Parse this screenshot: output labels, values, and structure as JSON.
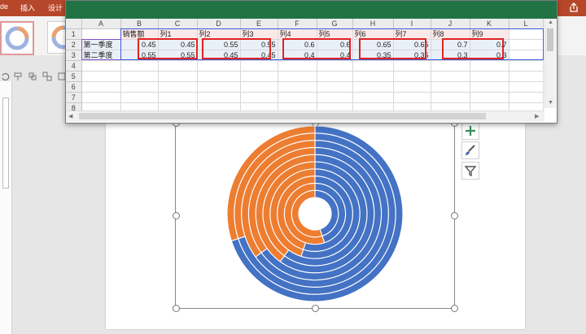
{
  "powerpoint": {
    "tabs": [
      {
        "label": "de"
      },
      {
        "label": "插入"
      },
      {
        "label": "设计"
      }
    ]
  },
  "excel": {
    "column_headers": [
      "A",
      "B",
      "C",
      "D",
      "E",
      "F",
      "G",
      "H",
      "I",
      "J",
      "K",
      "L"
    ],
    "row_numbers": [
      "1",
      "2",
      "3",
      "4",
      "5",
      "6",
      "7",
      "8"
    ],
    "header_row": [
      "销售额",
      "列1",
      "列2",
      "列3",
      "列4",
      "列5",
      "列6",
      "列7",
      "列8",
      "列9"
    ],
    "rows": [
      {
        "label": "第一季度",
        "values": [
          "0.45",
          "0.45",
          "0.55",
          "0.55",
          "0.6",
          "0.6",
          "0.65",
          "0.65",
          "0.7",
          "0.7"
        ]
      },
      {
        "label": "第二季度",
        "values": [
          "0.55",
          "0.55",
          "0.45",
          "0.45",
          "0.4",
          "0.4",
          "0.35",
          "0.35",
          "0.3",
          "0.3"
        ]
      }
    ]
  },
  "chart_data": {
    "type": "donut",
    "categories": [
      "第一季度",
      "第二季度"
    ],
    "series": [
      {
        "name": "销售额",
        "values": [
          0.45,
          0.55
        ]
      },
      {
        "name": "列1",
        "values": [
          0.45,
          0.55
        ]
      },
      {
        "name": "列2",
        "values": [
          0.55,
          0.45
        ]
      },
      {
        "name": "列3",
        "values": [
          0.55,
          0.45
        ]
      },
      {
        "name": "列4",
        "values": [
          0.6,
          0.4
        ]
      },
      {
        "name": "列5",
        "values": [
          0.6,
          0.4
        ]
      },
      {
        "name": "列6",
        "values": [
          0.65,
          0.35
        ]
      },
      {
        "name": "列7",
        "values": [
          0.65,
          0.35
        ]
      },
      {
        "name": "列8",
        "values": [
          0.7,
          0.3
        ]
      },
      {
        "name": "列9",
        "values": [
          0.7,
          0.3
        ]
      }
    ],
    "colors": [
      "#4472c4",
      "#ed7d31"
    ],
    "legend": "none"
  },
  "icons": {
    "chart_elements": "plus-icon",
    "chart_styles": "brush-icon",
    "chart_filters": "filter-icon"
  }
}
